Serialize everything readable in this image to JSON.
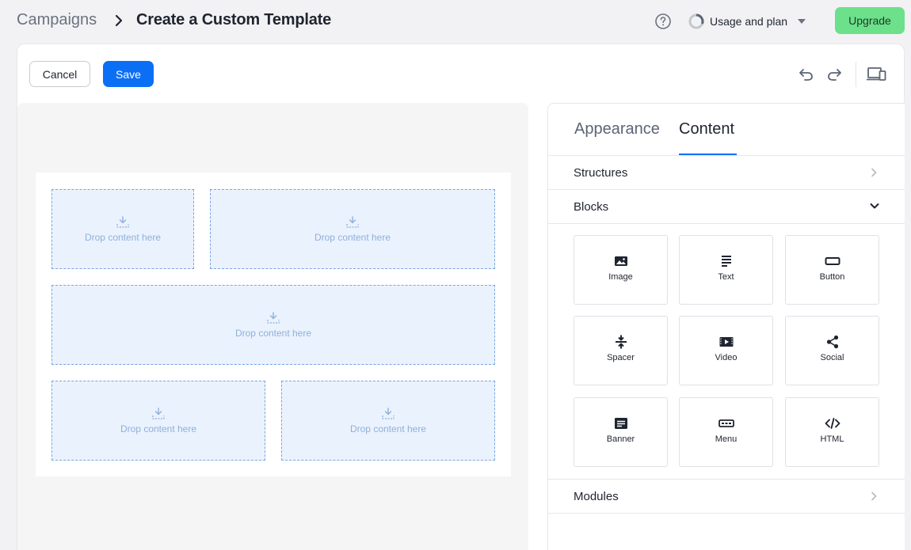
{
  "header": {
    "breadcrumb_parent": "Campaigns",
    "breadcrumb_current": "Create a Custom Template",
    "usage_label": "Usage and plan",
    "upgrade_label": "Upgrade"
  },
  "toolbar": {
    "cancel_label": "Cancel",
    "save_label": "Save"
  },
  "canvas": {
    "drop_label": "Drop content here"
  },
  "sidebar": {
    "tabs": [
      "Appearance",
      "Content"
    ],
    "active_tab": "Content",
    "sections": {
      "structures": "Structures",
      "blocks": "Blocks",
      "modules": "Modules"
    },
    "blocks": [
      {
        "label": "Image",
        "icon": "image-icon"
      },
      {
        "label": "Text",
        "icon": "text-icon"
      },
      {
        "label": "Button",
        "icon": "button-icon"
      },
      {
        "label": "Spacer",
        "icon": "spacer-icon"
      },
      {
        "label": "Video",
        "icon": "video-icon"
      },
      {
        "label": "Social",
        "icon": "share-icon"
      },
      {
        "label": "Banner",
        "icon": "banner-icon"
      },
      {
        "label": "Menu",
        "icon": "menu-icon"
      },
      {
        "label": "HTML",
        "icon": "code-icon"
      }
    ]
  },
  "colors": {
    "primary": "#0b6ff5",
    "upgrade": "#6ce08a",
    "drop_bg": "#eaf2fd",
    "drop_border": "#7aa6de"
  }
}
